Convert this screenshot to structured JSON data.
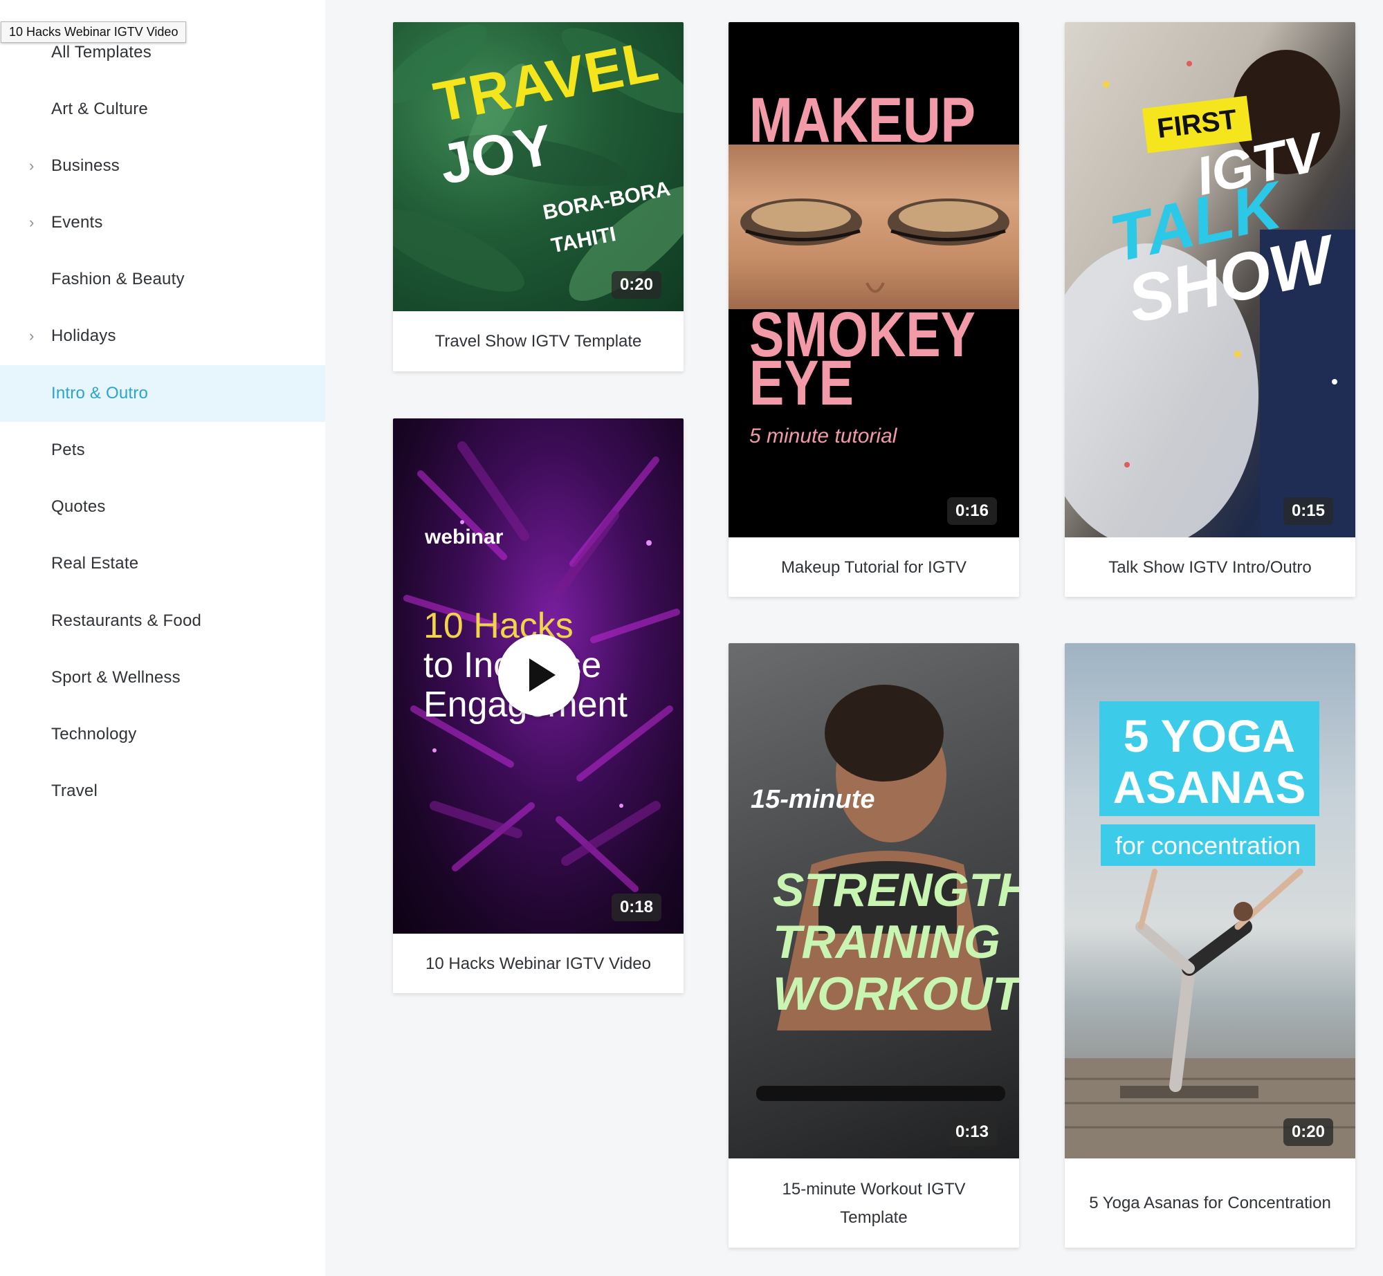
{
  "tooltip": "10 Hacks Webinar IGTV Video",
  "sidebar": {
    "items": [
      {
        "label": "All Templates",
        "chevron": false,
        "active": false
      },
      {
        "label": "Art & Culture",
        "chevron": false,
        "active": false
      },
      {
        "label": "Business",
        "chevron": true,
        "active": false
      },
      {
        "label": "Events",
        "chevron": true,
        "active": false
      },
      {
        "label": "Fashion & Beauty",
        "chevron": false,
        "active": false
      },
      {
        "label": "Holidays",
        "chevron": true,
        "active": false
      },
      {
        "label": "Intro & Outro",
        "chevron": false,
        "active": true
      },
      {
        "label": "Pets",
        "chevron": false,
        "active": false
      },
      {
        "label": "Quotes",
        "chevron": false,
        "active": false
      },
      {
        "label": "Real Estate",
        "chevron": false,
        "active": false
      },
      {
        "label": "Restaurants & Food",
        "chevron": false,
        "active": false
      },
      {
        "label": "Sport & Wellness",
        "chevron": false,
        "active": false
      },
      {
        "label": "Technology",
        "chevron": false,
        "active": false
      },
      {
        "label": "Travel",
        "chevron": false,
        "active": false
      }
    ],
    "chevron_glyph": "›",
    "active_color": "#2aa4cf"
  },
  "cards": {
    "travel": {
      "title": "Travel Show IGTV Template",
      "duration": "0:20",
      "overlay": {
        "line1": "TRAVEL",
        "line2": "JOY",
        "line3": "BORA-BORA",
        "line4": "TAHITI"
      }
    },
    "webinar": {
      "title": "10 Hacks Webinar IGTV Video",
      "duration": "0:18",
      "overlay": {
        "tag": "webinar",
        "line1": "10 Hacks",
        "line2": "to Increase",
        "line3": "Engagement"
      },
      "play_icon": "play-icon"
    },
    "makeup": {
      "title": "Makeup Tutorial for IGTV",
      "duration": "0:16",
      "overlay": {
        "line1": "MAKEUP",
        "line2": "SMOKEY",
        "line3": "EYE",
        "line4": "5 minute tutorial"
      }
    },
    "talkshow": {
      "title": "Talk Show IGTV Intro/Outro",
      "duration": "0:15",
      "overlay": {
        "line1": "FIRST",
        "line2": "IGTV",
        "line3": "TALK",
        "line4": "SHOW"
      }
    },
    "workout": {
      "title": "15-minute Workout IGTV Template",
      "duration": "0:13",
      "overlay": {
        "line1": "15-minute",
        "line2": "STRENGTH",
        "line3": "TRAINING",
        "line4": "WORKOUT"
      }
    },
    "yoga": {
      "title": "5 Yoga Asanas for Concentration",
      "duration": "0:20",
      "overlay": {
        "line1": "5 YOGA",
        "line2": "ASANAS",
        "line3": "for concentration"
      }
    }
  }
}
